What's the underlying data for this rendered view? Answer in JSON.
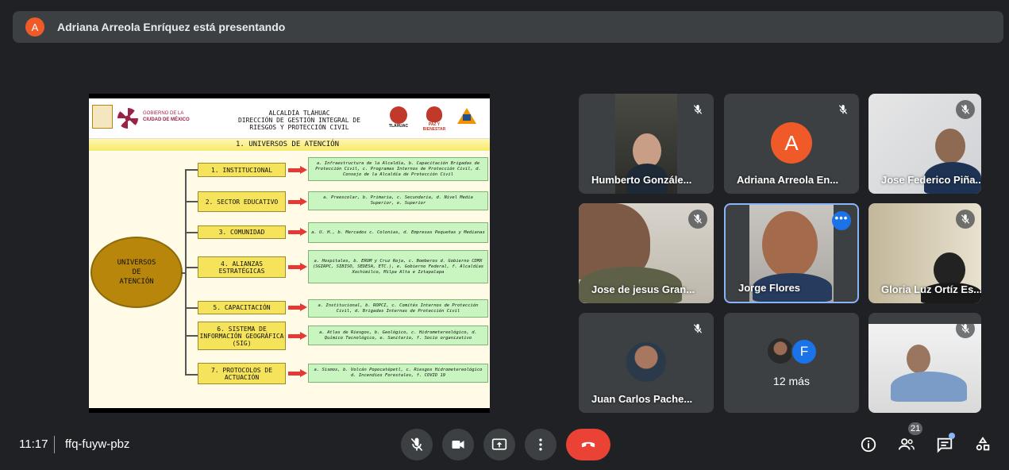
{
  "banner": {
    "avatar_letter": "A",
    "text": "Adriana Arreola Enríquez está presentando"
  },
  "slide": {
    "logo_gov_line1": "GOBIERNO DE LA",
    "logo_gov_line2": "CIUDAD DE MÉXICO",
    "header_line1": "ALCALDÍA TLÁHUAC",
    "header_line2": "DIRECCIÓN DE GESTIÓN INTEGRAL DE",
    "header_line3": "RIESGOS Y PROTECCIÓN CIVIL",
    "tlahuac_logo_text": "TLÁHUAC",
    "paz_logo_text": "PAZ Y BIENESTAR",
    "subtitle": "1. UNIVERSOS DE ATENCIÓN",
    "center_line1": "UNIVERSOS",
    "center_line2": "DE",
    "center_line3": "ATENCIÓN",
    "categories": [
      {
        "label": "1. INSTITUCIONAL",
        "desc": "a. Infraestructura de la Alcaldía, b. Capacitación Brigadas de Protección Civil, c. Programas Internos de Protección Civil, d. Consejo de la Alcaldía de Protección Civil"
      },
      {
        "label": "2. SECTOR EDUCATIVO",
        "desc": "a. Preescolar, b. Primaria, c. Secundaria, d. Nivel Media Superior, e. Superior"
      },
      {
        "label": "3. COMUNIDAD",
        "desc": "a. U. H., b. Mercados c. Colonias, d. Empresas Pequeñas y Medianas"
      },
      {
        "label": "4. ALIANZAS ESTRATÉGICAS",
        "desc": "a. Hospitales, b. ERUM y Cruz Roja, c. Bomberos d. Gobierno CDMX (SGIRPC, SIBISO, SEDESA, ETC.), e. Gobierno Federal, f. Alcaldías Xochimilco, Milpa Alta e Iztapalapa"
      },
      {
        "label": "5. CAPACITACIÓN",
        "desc": "a. Institucional, b. ROPCI, c. Comités Internos de Protección Civil, d. Brigadas Internas de Protección Civil"
      },
      {
        "label": "6. SISTEMA DE INFORMACIÓN GEOGRÁFICA (SIG)",
        "desc": "a. Atlas de Riesgos, b. Geológico, c. Hidrometereológico, d. Químico Tecnológico, e. Sanitario, f. Socio organizativo"
      },
      {
        "label": "7. PROTOCOLOS DE ACTUACIÓN",
        "desc": "a. Sismos, b. Volcán Popocatépetl, c. Riesgos Hidrometereológico d. Incendios Forestales, f. COVID 19"
      }
    ]
  },
  "participants": [
    {
      "name": "Humberto Gonzále..."
    },
    {
      "name": "Adriana Arreola En...",
      "avatar_letter": "A"
    },
    {
      "name": "Jose Federico Piña..."
    },
    {
      "name": "Jose de jesus Gran..."
    },
    {
      "name": "Jorge Flores"
    },
    {
      "name": "Gloria Luz Ortíz Es..."
    },
    {
      "name": "Juan Carlos Pache..."
    },
    {
      "name": "12 más",
      "avatar_letter": "F"
    },
    {
      "name": ""
    }
  ],
  "footer": {
    "time": "11:17",
    "meeting_code": "ffq-fuyw-pbz",
    "participant_count": "21"
  },
  "colors": {
    "hangup": "#ea4335",
    "active_border": "#8ab4f8",
    "avatar_orange": "#f05a28",
    "avatar_blue": "#1a73e8"
  }
}
